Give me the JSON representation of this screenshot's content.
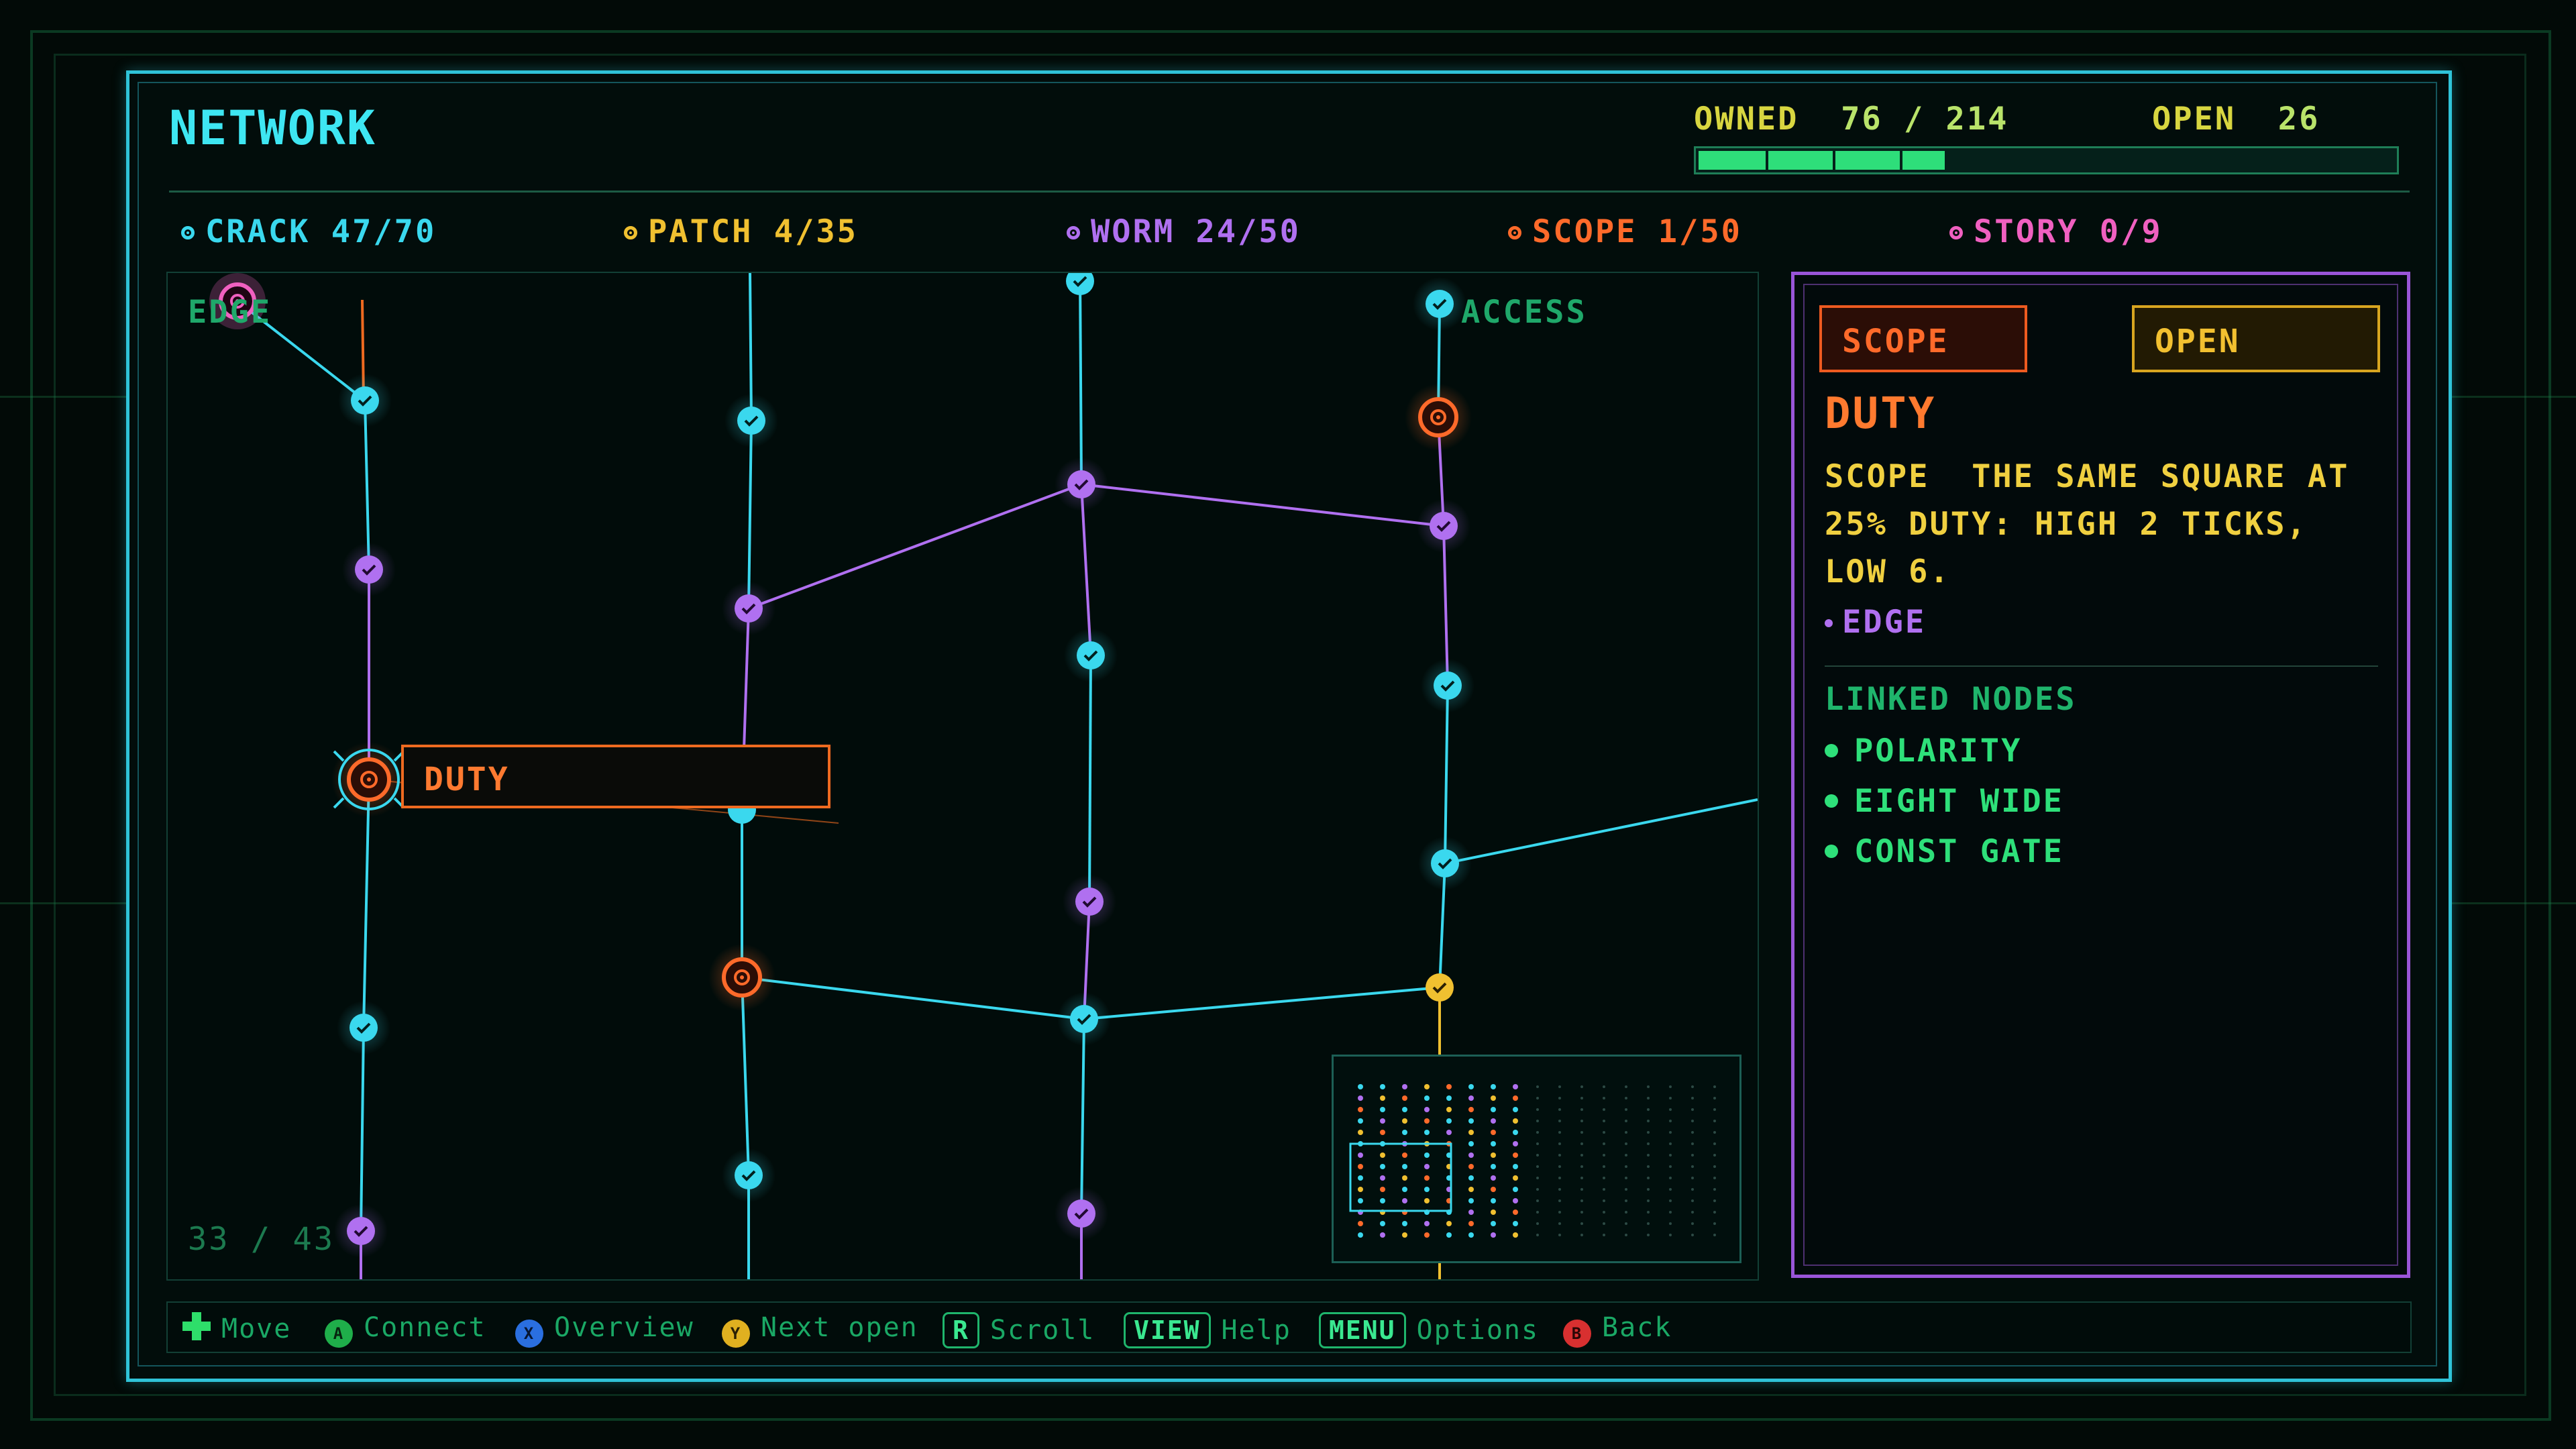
{
  "title": "NETWORK",
  "owned": {
    "label": "OWNED",
    "value": "76 / 214",
    "progress": 0.355
  },
  "open": {
    "label": "OPEN",
    "value": "26"
  },
  "categories": [
    {
      "label": "CRACK 47/70",
      "color": "#3ad8ee"
    },
    {
      "label": "PATCH 4/35",
      "color": "#f0c030"
    },
    {
      "label": "WORM 24/50",
      "color": "#b070f0"
    },
    {
      "label": "SCOPE 1/50",
      "color": "#ff6a2a"
    },
    {
      "label": "STORY 0/9",
      "color": "#f060c0"
    }
  ],
  "map": {
    "column_labels": [
      "EDGE",
      "ACCESS"
    ],
    "counter": "33 / 43",
    "selected_label": "DUTY"
  },
  "panel": {
    "type_button": "SCOPE",
    "status_button": "OPEN",
    "title": "DUTY",
    "description": "SCOPE  THE SAME SQUARE AT\n25% DUTY: HIGH 2 TICKS,\nLOW 6.",
    "tag": "EDGE",
    "linked_heading": "LINKED NODES",
    "linked": [
      "POLARITY",
      "EIGHT WIDE",
      "CONST GATE"
    ]
  },
  "footer": {
    "move": "Move",
    "connect_glyph": "A",
    "connect": "Connect",
    "overview_glyph": "X",
    "overview": "Overview",
    "next_glyph": "Y",
    "next_open": "Next open",
    "scroll_key": "R",
    "scroll": "Scroll",
    "view_key": "VIEW",
    "help": "Help",
    "menu_key": "MENU",
    "options": "Options",
    "back_glyph": "B",
    "back": "Back"
  },
  "colors": {
    "crack": "#3ad8ee",
    "worm": "#b070f0",
    "scope": "#ff6a2a",
    "patch": "#f0c030",
    "story": "#f060c0",
    "accent": "#2fc3d8",
    "panel_border": "#9a55d8"
  }
}
